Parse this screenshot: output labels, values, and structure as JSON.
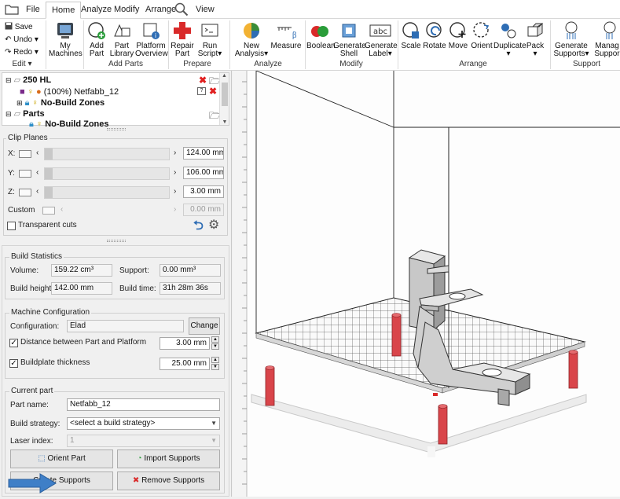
{
  "tabs": [
    {
      "label": "File"
    },
    {
      "label": "Home"
    },
    {
      "label": "Analyze"
    },
    {
      "label": "Modify"
    },
    {
      "label": "Arrange"
    },
    {
      "label": "View"
    }
  ],
  "ribbon": {
    "edit": {
      "save": "Save",
      "undo": "Undo",
      "redo": "Redo",
      "group": "Edit"
    },
    "machines": {
      "line1": "My",
      "line2": "Machines"
    },
    "add_part": {
      "line1": "Add",
      "line2": "Part"
    },
    "part_library": {
      "line1": "Part",
      "line2": "Library"
    },
    "platform_overview": {
      "line1": "Platform",
      "line2": "Overview"
    },
    "add_parts_group": "Add Parts",
    "repair_part": {
      "line1": "Repair",
      "line2": "Part"
    },
    "run_script": {
      "line1": "Run",
      "line2": "Script"
    },
    "prepare_group": "Prepare",
    "new_analysis": {
      "line1": "New",
      "line2": "Analysis"
    },
    "measure": "Measure",
    "analyze_group": "Analyze",
    "boolean": "Boolean",
    "generate_shell": {
      "line1": "Generate",
      "line2": "Shell"
    },
    "generate_label": {
      "line1": "Generate",
      "line2": "Label"
    },
    "modify_group": "Modify",
    "scale": "Scale",
    "rotate": "Rotate",
    "move": "Move",
    "orient": "Orient",
    "duplicate": "Duplicate",
    "pack": "Pack",
    "arrange_group": "Arrange",
    "generate_supports": {
      "line1": "Generate",
      "line2": "Supports"
    },
    "manage_supports": {
      "line1": "Manag",
      "line2": "Suppor"
    },
    "support_group": "Support"
  },
  "tree": {
    "platform": "250 HL",
    "part_entry": "(100%) Netfabb_12",
    "nbz1": "No-Build Zones",
    "parts": "Parts",
    "nbz2": "No-Build Zones"
  },
  "clip": {
    "title": "Clip Planes",
    "x_label": "X:",
    "x_value": "124.00 mm",
    "y_label": "Y:",
    "y_value": "106.00 mm",
    "z_label": "Z:",
    "z_value": "3.00 mm",
    "custom_label": "Custom",
    "custom_value": "0.00 mm",
    "transparent": "Transparent cuts"
  },
  "build_stats": {
    "title": "Build Statistics",
    "volume_label": "Volume:",
    "volume": "159.22 cm³",
    "support_label": "Support:",
    "support": "0.00 mm³",
    "height_label": "Build height:",
    "height": "142.00 mm",
    "time_label": "Build time:",
    "time": "31h 28m 36s"
  },
  "machine": {
    "title": "Machine Configuration",
    "config_label": "Configuration:",
    "config_value": "Elad",
    "change": "Change",
    "distance_label": "Distance between Part and Platform",
    "distance_value": "3.00 mm",
    "buildplate_label": "Buildplate thickness",
    "buildplate_value": "25.00 mm"
  },
  "current_part": {
    "title": "Current part",
    "name_label": "Part name:",
    "name_value": "Netfabb_12",
    "strategy_label": "Build strategy:",
    "strategy_value": "<select a build strategy>",
    "laser_label": "Laser index:",
    "laser_value": "1",
    "orient": "Orient Part",
    "import": "Import Supports",
    "create": "Create Supports",
    "remove": "Remove Supports"
  },
  "colors": {
    "accent": "#2e6db4",
    "support_pin": "#d9454a",
    "danger": "#e02020"
  }
}
